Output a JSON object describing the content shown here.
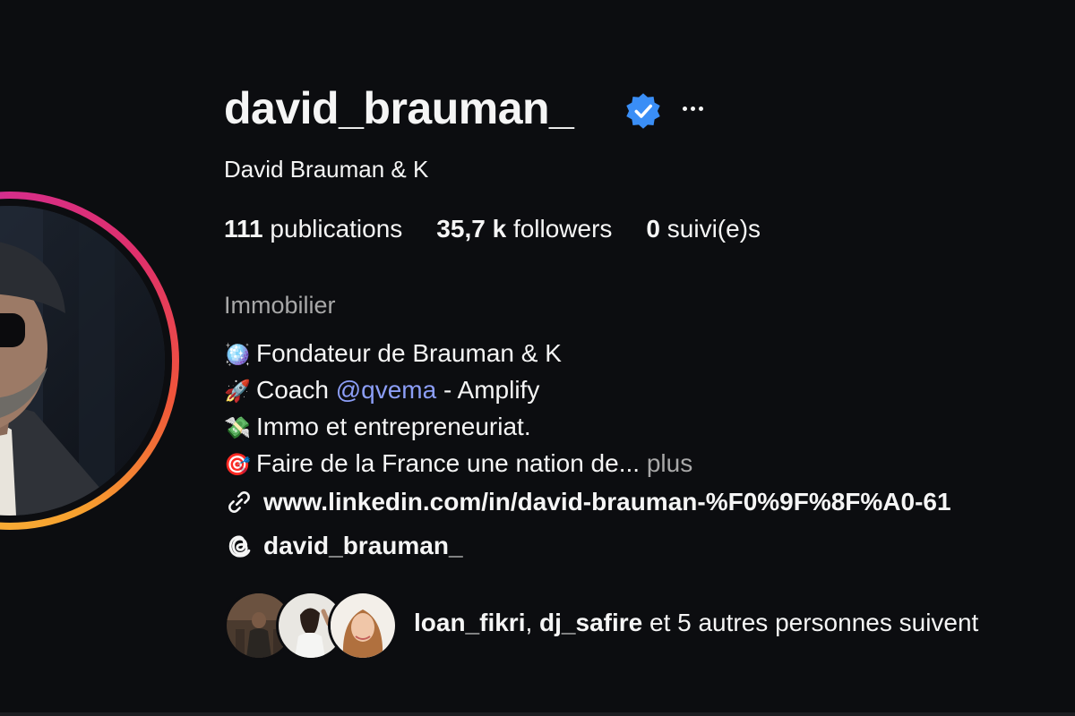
{
  "profile": {
    "username": "david_brauman_",
    "full_name": "David Brauman & K",
    "verified": true,
    "more_icon": "more-horizontal-icon"
  },
  "stats": {
    "posts_count": "111",
    "posts_label": "publications",
    "followers_count": "35,7 k",
    "followers_label": "followers",
    "following_count": "0",
    "following_label": "suivi(e)s"
  },
  "bio": {
    "category": "Immobilier",
    "lines": [
      {
        "emoji": "🪩",
        "icon": "disco-ball-icon",
        "text": "Fondateur de Brauman & K"
      },
      {
        "emoji": "🚀",
        "icon": "rocket-icon",
        "prefix": "Coach ",
        "mention": "@qvema",
        "suffix": " - Amplify"
      },
      {
        "emoji": "💸",
        "icon": "money-wings-icon",
        "text": "Immo et entrepreneuriat."
      },
      {
        "emoji": "🎯",
        "icon": "target-icon",
        "text": "Faire de la France une nation de...",
        "more": "plus"
      }
    ]
  },
  "links": {
    "website": "www.linkedin.com/in/david-brauman-%F0%9F%8F%A0-61",
    "threads": "david_brauman_"
  },
  "followed_by": {
    "user1": "loan_fikri",
    "separator": ", ",
    "user2": "dj_safire",
    "rest": " et 5 autres personnes suivent"
  },
  "colors": {
    "background": "#0c0d10",
    "text": "#f5f5f5",
    "muted": "#a8a8a8",
    "mention": "#8c9ef7",
    "verified": "#3a8ef6"
  }
}
